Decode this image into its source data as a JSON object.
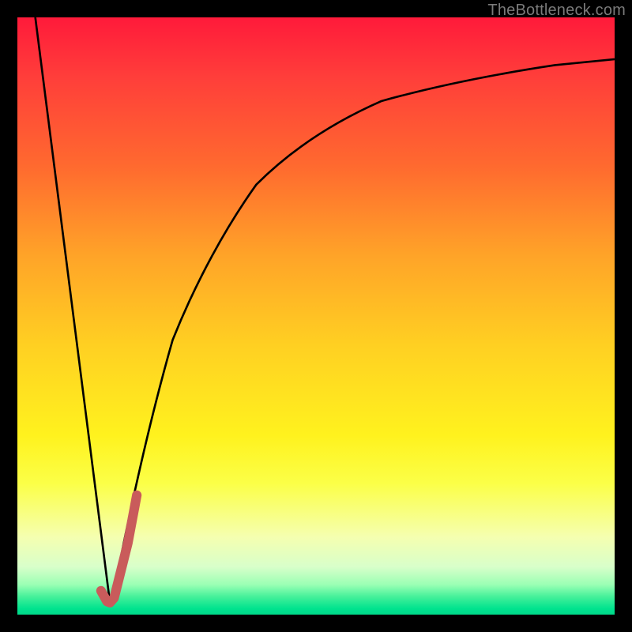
{
  "watermark": {
    "text": "TheBottleneck.com"
  },
  "colors": {
    "frame": "#000000",
    "curve": "#000000",
    "highlight": "#c95b5b",
    "watermark": "#7a7a7a",
    "gradient_stops": [
      "#ff1a3a",
      "#ff3e3a",
      "#ff6a2f",
      "#ffa428",
      "#ffd022",
      "#fff21e",
      "#fbff47",
      "#f5ffb0",
      "#d8ffca",
      "#9affb4",
      "#45f09a",
      "#00e38e",
      "#00d88a"
    ]
  },
  "chart_data": {
    "type": "line",
    "title": "",
    "xlabel": "",
    "ylabel": "",
    "xlim": [
      0,
      100
    ],
    "ylim": [
      0,
      100
    ],
    "series": [
      {
        "name": "left-slope",
        "x": [
          3,
          15.5
        ],
        "y": [
          100,
          2
        ]
      },
      {
        "name": "right-curve",
        "x": [
          15.5,
          17,
          19,
          22,
          26,
          30,
          35,
          40,
          46,
          53,
          61,
          70,
          80,
          90,
          100
        ],
        "y": [
          2,
          8,
          18,
          32,
          46,
          56,
          65,
          72,
          78,
          82.5,
          86,
          88.5,
          90.5,
          92,
          93
        ]
      },
      {
        "name": "highlight-segment",
        "x": [
          14,
          15.5,
          17,
          18.5,
          20
        ],
        "y": [
          4,
          2,
          6,
          12,
          20
        ]
      }
    ],
    "annotations": []
  }
}
